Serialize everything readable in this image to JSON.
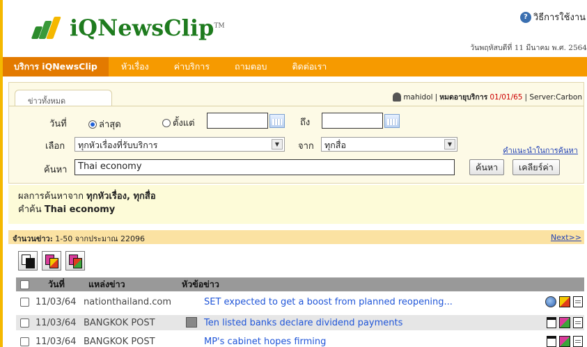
{
  "brand": {
    "logo_text": "iQNewsClip",
    "trademark": "TM"
  },
  "header": {
    "help_label": "วิธีการใช้งาน",
    "date_text": "วันพฤหัสบดีที่ 11 มีนาคม พ.ศ. 2564"
  },
  "nav": {
    "items": [
      "บริการ iQNewsClip",
      "หัวเรื่อง",
      "ค่าบริการ",
      "ถามตอบ",
      "ติดต่อเรา"
    ]
  },
  "search": {
    "tab_label": "ข่าวทั้งหมด",
    "user": "mahidol",
    "expiry_label": "หมดอายุบริการ",
    "expiry_date": "01/01/65",
    "server": "| Server:Carbon",
    "date_label": "วันที่",
    "radio_latest": "ล่าสุด",
    "radio_from": "ตั้งแต่",
    "to_label": "ถึง",
    "select_label": "เลือก",
    "topic_value": "ทุกหัวเรื่องที่รับบริการ",
    "source_label": "จาก",
    "source_value": "ทุกสื่อ",
    "tip_link": "คำแนะนำในการค้นหา",
    "query_label": "ค้นหา",
    "query_value": "Thai economy",
    "search_button": "ค้นหา",
    "clear_button": "เคลียร์ค่า"
  },
  "result_summary": {
    "line1_prefix": "ผลการค้นหาจาก",
    "line1_value": "ทุกหัวเรื่อง, ทุกสื่อ",
    "line2_prefix": "คำค้น",
    "line2_value": "Thai economy"
  },
  "count_bar": {
    "label": "จำนวนข่าว:",
    "value": "1-50 จากประมาณ 22096",
    "next": "Next>>"
  },
  "table": {
    "headers": {
      "date": "วันที่",
      "source": "แหล่งข่าว",
      "title": "หัวข้อข่าว"
    },
    "rows": [
      {
        "date": "11/03/64",
        "source": "nationthailand.com",
        "title": "SET expected to get a boost from planned reopening..."
      },
      {
        "date": "11/03/64",
        "source": "BANGKOK POST",
        "title": "Ten listed banks declare dividend payments"
      },
      {
        "date": "11/03/64",
        "source": "BANGKOK POST",
        "title": "MP's cabinet hopes firming"
      }
    ]
  }
}
